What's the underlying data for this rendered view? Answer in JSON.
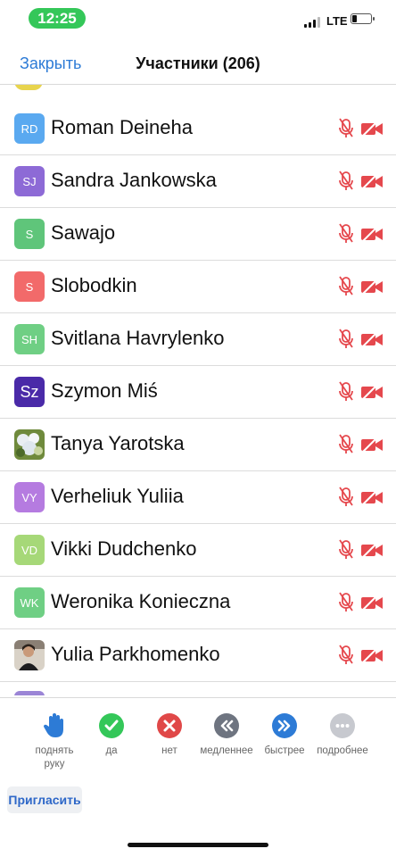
{
  "status_bar": {
    "time": "12:25",
    "network": "LTE",
    "battery_percent": 25
  },
  "nav": {
    "close_label": "Закрыть",
    "title": "Участники (206)"
  },
  "participants": [
    {
      "initials": "RD",
      "name": "Roman Deineha",
      "color": "#5aa9f0",
      "mic_muted": true,
      "video_off": true
    },
    {
      "initials": "SJ",
      "name": "Sandra Jankowska",
      "color": "#8d6ad6",
      "mic_muted": true,
      "video_off": true
    },
    {
      "initials": "S",
      "name": "Sawajo",
      "color": "#5fc57a",
      "mic_muted": true,
      "video_off": true
    },
    {
      "initials": "S",
      "name": "Slobodkin",
      "color": "#f26a6a",
      "mic_muted": true,
      "video_off": true
    },
    {
      "initials": "SH",
      "name": "Svitlana Havrylenko",
      "color": "#6fcf84",
      "mic_muted": true,
      "video_off": true
    },
    {
      "initials": "Sz",
      "name": "Szymon Miś",
      "color": "#4a2aa8",
      "mic_muted": true,
      "video_off": true
    },
    {
      "initials": "",
      "name": "Tanya Yarotska",
      "photo": "flowers",
      "mic_muted": true,
      "video_off": true
    },
    {
      "initials": "VY",
      "name": "Verheliuk Yuliia",
      "color": "#b57be0",
      "mic_muted": true,
      "video_off": true
    },
    {
      "initials": "VD",
      "name": "Vikki Dudchenko",
      "color": "#a6d878",
      "mic_muted": true,
      "video_off": true
    },
    {
      "initials": "WK",
      "name": "Weronika Konieczna",
      "color": "#6fcf84",
      "mic_muted": true,
      "video_off": true
    },
    {
      "initials": "",
      "name": "Yulia Parkhomenko",
      "photo": "person",
      "mic_muted": true,
      "video_off": true
    }
  ],
  "reactions": [
    {
      "id": "raise-hand",
      "label": "поднять руку",
      "icon": "raise-hand-icon",
      "color": "#2d7bd6"
    },
    {
      "id": "yes",
      "label": "да",
      "icon": "check-icon",
      "color": "#34c759"
    },
    {
      "id": "no",
      "label": "нет",
      "icon": "x-icon",
      "color": "#e04848"
    },
    {
      "id": "slower",
      "label": "медленнее",
      "icon": "rewind-icon",
      "color": "#6e7480"
    },
    {
      "id": "faster",
      "label": "быстрее",
      "icon": "fast-forward-icon",
      "color": "#2d7bd6"
    },
    {
      "id": "more",
      "label": "подробнее",
      "icon": "more-icon",
      "color": "#c7c9cf"
    }
  ],
  "invite_label": "Пригласить",
  "colors": {
    "accent": "#2d7bd6",
    "muted_red": "#e5484d"
  }
}
